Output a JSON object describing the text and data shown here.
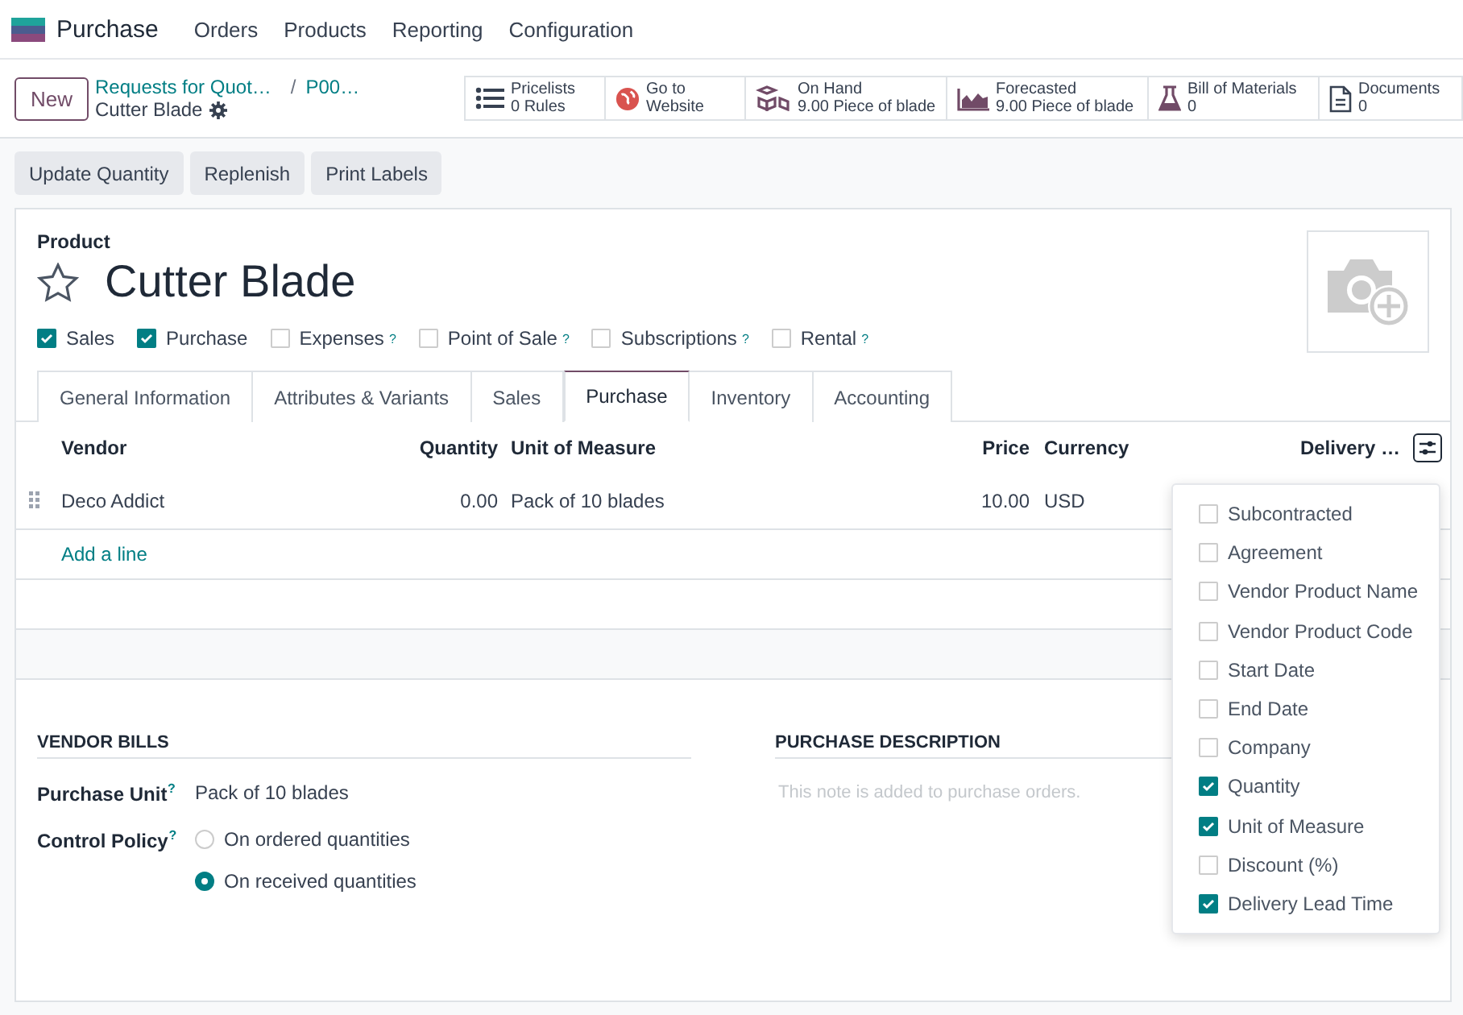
{
  "app": {
    "name": "Purchase",
    "menu": [
      "Orders",
      "Products",
      "Reporting",
      "Configuration"
    ]
  },
  "control_panel": {
    "new_button": "New",
    "breadcrumbs": [
      "Requests for Quot…",
      "P00…"
    ],
    "separator": "/",
    "record": "Cutter Blade"
  },
  "smart_buttons": [
    {
      "kind": "list",
      "title": "Pricelists",
      "value": "0 Rules"
    },
    {
      "kind": "globe",
      "title": "Go to",
      "value": "Website"
    },
    {
      "kind": "boxes",
      "title": "On Hand",
      "value": "9.00 Piece of blade"
    },
    {
      "kind": "chart",
      "title": "Forecasted",
      "value": "9.00 Piece of blade"
    },
    {
      "kind": "flask",
      "title": "Bill of Materials",
      "value": "0"
    },
    {
      "kind": "document",
      "title": "Documents",
      "value": "0"
    }
  ],
  "action_buttons": [
    "Update Quantity",
    "Replenish",
    "Print Labels"
  ],
  "product": {
    "label": "Product",
    "name": "Cutter Blade",
    "favorite": false
  },
  "options": [
    {
      "label": "Sales",
      "checked": true
    },
    {
      "label": "Purchase",
      "checked": true
    },
    {
      "label": "Expenses",
      "checked": false,
      "help": "?"
    },
    {
      "label": "Point of Sale",
      "checked": false,
      "help": "?"
    },
    {
      "label": "Subscriptions",
      "checked": false,
      "help": "?"
    },
    {
      "label": "Rental",
      "checked": false,
      "help": "?"
    }
  ],
  "tabs": [
    {
      "label": "General Information",
      "selected": false
    },
    {
      "label": "Attributes & Variants",
      "selected": false
    },
    {
      "label": "Sales",
      "selected": false
    },
    {
      "label": "Purchase",
      "selected": true
    },
    {
      "label": "Inventory",
      "selected": false
    },
    {
      "label": "Accounting",
      "selected": false
    }
  ],
  "vendor_table": {
    "columns": [
      "Vendor",
      "Quantity",
      "Unit of Measure",
      "Price",
      "Currency",
      "Delivery …"
    ],
    "rows": [
      {
        "cells": [
          "Deco Addict",
          "0.00",
          "Pack of 10 blades",
          "10.00",
          "USD"
        ]
      }
    ],
    "add_line": "Add a line"
  },
  "column_menu": [
    {
      "label": "Subcontracted",
      "checked": false
    },
    {
      "label": "Agreement",
      "checked": false
    },
    {
      "label": "Vendor Product Name",
      "checked": false
    },
    {
      "label": "Vendor Product Code",
      "checked": false
    },
    {
      "label": "Start Date",
      "checked": false
    },
    {
      "label": "End Date",
      "checked": false
    },
    {
      "label": "Company",
      "checked": false
    },
    {
      "label": "Quantity",
      "checked": true
    },
    {
      "label": "Unit of Measure",
      "checked": true
    },
    {
      "label": "Discount (%)",
      "checked": false
    },
    {
      "label": "Delivery Lead Time",
      "checked": true
    }
  ],
  "vendor_bills": {
    "title": "VENDOR BILLS",
    "purchase_unit": {
      "label": "Purchase Unit",
      "help": "?",
      "value": "Pack of 10 blades"
    },
    "control_policy": {
      "label": "Control Policy",
      "help": "?",
      "options": [
        {
          "label": "On ordered quantities",
          "selected": false
        },
        {
          "label": "On received quantities",
          "selected": true
        }
      ]
    }
  },
  "purchase_description": {
    "title": "PURCHASE DESCRIPTION",
    "placeholder": "This note is added to purchase orders."
  }
}
